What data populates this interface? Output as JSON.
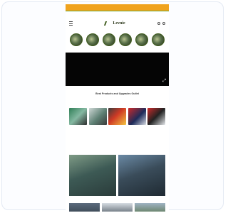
{
  "topbar": {
    "text": ""
  },
  "statusbar": {
    "left": "",
    "right": ""
  },
  "header": {
    "logo_text": "Levnie"
  },
  "categories": [
    {
      "label": ""
    },
    {
      "label": ""
    },
    {
      "label": ""
    },
    {
      "label": ""
    },
    {
      "label": ""
    },
    {
      "label": ""
    }
  ],
  "section": {
    "title": "Best Products and Upgrades Outlet",
    "subtitle": ""
  },
  "products": [
    {
      "name": "",
      "price": "",
      "old_price": ""
    },
    {
      "name": "",
      "price": "",
      "old_price": ""
    },
    {
      "name": "",
      "price": "",
      "old_price": ""
    },
    {
      "name": "",
      "price": "",
      "old_price": ""
    },
    {
      "name": "",
      "price": "",
      "old_price": ""
    }
  ],
  "promos": [
    {
      "text": ""
    },
    {
      "text": ""
    }
  ],
  "colors": {
    "accent": "#f0a31e",
    "brand_green": "#3d5a1b",
    "price": "#e07a1c"
  },
  "icons": {
    "menu": "hamburger-icon",
    "search": "search-icon",
    "cart": "cart-icon",
    "fullscreen": "expand-icon"
  }
}
